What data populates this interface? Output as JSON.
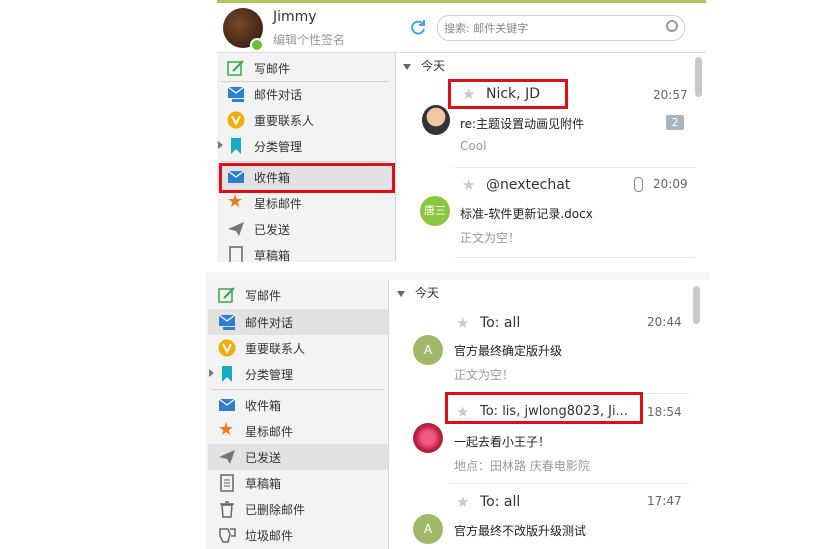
{
  "top_panel": {
    "user": {
      "name": "Jimmy",
      "signature_placeholder": "编辑个性签名",
      "status_color": "#6cbf3a"
    },
    "search": {
      "placeholder": "搜索: 邮件关键字"
    },
    "sidebar": {
      "items": [
        {
          "label": "写邮件",
          "icon": "compose-icon"
        },
        {
          "label": "邮件对话",
          "icon": "conversation-icon"
        },
        {
          "label": "重要联系人",
          "icon": "vip-icon"
        },
        {
          "label": "分类管理",
          "icon": "bookmark-icon"
        },
        {
          "label": "收件箱",
          "icon": "inbox-icon",
          "selected": true
        },
        {
          "label": "星标邮件",
          "icon": "star-icon"
        },
        {
          "label": "已发送",
          "icon": "sent-icon"
        },
        {
          "label": "草稿箱",
          "icon": "draft-icon"
        }
      ]
    },
    "list": {
      "day_header": "今天",
      "messages": [
        {
          "sender": "Nick, JD",
          "time": "20:57",
          "subject": "re:主题设置动画见附件",
          "preview": "Cool",
          "count": "2",
          "highlighted": true
        },
        {
          "sender": "@nextechat",
          "time": "20:09",
          "subject": "标准-软件更新记录.docx",
          "preview": "正文为空！",
          "avatar_text": "唐三",
          "avatar_color": "#8cc63f",
          "attachment": true
        }
      ]
    }
  },
  "bottom_panel": {
    "sidebar": {
      "items": [
        {
          "label": "写邮件",
          "icon": "compose-icon"
        },
        {
          "label": "邮件对话",
          "icon": "conversation-icon",
          "selected": true
        },
        {
          "label": "重要联系人",
          "icon": "vip-icon"
        },
        {
          "label": "分类管理",
          "icon": "bookmark-icon"
        },
        {
          "label": "收件箱",
          "icon": "inbox-icon"
        },
        {
          "label": "星标邮件",
          "icon": "star-icon"
        },
        {
          "label": "已发送",
          "icon": "sent-icon",
          "selected": true
        },
        {
          "label": "草稿箱",
          "icon": "draft-icon"
        },
        {
          "label": "已删除邮件",
          "icon": "trash-icon"
        },
        {
          "label": "垃圾邮件",
          "icon": "spam-icon"
        }
      ]
    },
    "list": {
      "day_header": "今天",
      "messages": [
        {
          "sender": "To: all",
          "time": "20:44",
          "subject": "官方最终确定版升级",
          "preview": "正文为空！",
          "avatar_text": "A",
          "avatar_color": "#9fb86a"
        },
        {
          "sender": "To: lis, jwlong8023, Ji...",
          "time": "18:54",
          "subject": "一起去看小王子！",
          "preview": "地点：田林路 庆春电影院",
          "highlighted": true
        },
        {
          "sender": "To: all",
          "time": "17:47",
          "subject": "官方最终不改版升级测试",
          "preview": "",
          "avatar_text": "A",
          "avatar_color": "#9fb86a"
        }
      ]
    }
  },
  "colors": {
    "accent_green": "#a6c85a",
    "highlight_red": "#d9101a",
    "selected_bg": "#e2e2e2"
  }
}
